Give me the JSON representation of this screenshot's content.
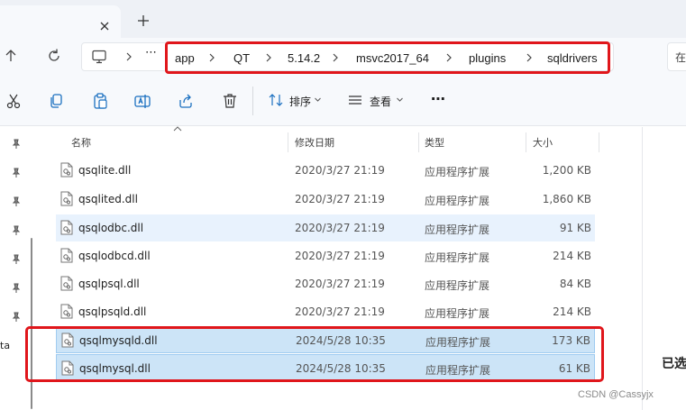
{
  "tabs": {
    "close_icon": "close-icon",
    "new_tab_icon": "plus-icon"
  },
  "address": {
    "more": "⋯",
    "breadcrumbs": [
      "app",
      "QT",
      "5.14.2",
      "msvc2017_64",
      "plugins",
      "sqldrivers"
    ],
    "search_partial": "在"
  },
  "toolbar": {
    "sort_label": "排序",
    "view_label": "查看",
    "more": "⋯"
  },
  "columns": {
    "name": "名称",
    "date": "修改日期",
    "type": "类型",
    "size": "大小"
  },
  "files": [
    {
      "name": "qsqlite.dll",
      "date": "2020/3/27 21:19",
      "type": "应用程序扩展",
      "size": "1,200 KB",
      "state": "normal"
    },
    {
      "name": "qsqlited.dll",
      "date": "2020/3/27 21:19",
      "type": "应用程序扩展",
      "size": "1,860 KB",
      "state": "normal"
    },
    {
      "name": "qsqlodbc.dll",
      "date": "2020/3/27 21:19",
      "type": "应用程序扩展",
      "size": "91 KB",
      "state": "hover"
    },
    {
      "name": "qsqlodbcd.dll",
      "date": "2020/3/27 21:19",
      "type": "应用程序扩展",
      "size": "214 KB",
      "state": "normal"
    },
    {
      "name": "qsqlpsql.dll",
      "date": "2020/3/27 21:19",
      "type": "应用程序扩展",
      "size": "84 KB",
      "state": "normal"
    },
    {
      "name": "qsqlpsqld.dll",
      "date": "2020/3/27 21:19",
      "type": "应用程序扩展",
      "size": "214 KB",
      "state": "normal"
    },
    {
      "name": "qsqlmysqld.dll",
      "date": "2024/5/28 10:35",
      "type": "应用程序扩展",
      "size": "173 KB",
      "state": "selected"
    },
    {
      "name": "qsqlmysql.dll",
      "date": "2024/5/28 10:35",
      "type": "应用程序扩展",
      "size": "61 KB",
      "state": "selected"
    }
  ],
  "leftnav": {
    "partial_label": "ta"
  },
  "details": {
    "partial_text": "已选"
  },
  "watermark": "CSDN @Cassyjx",
  "colors": {
    "highlight_red": "#e0161b",
    "selected_row": "#cce4f7",
    "hover_row": "#e8f2fd"
  }
}
